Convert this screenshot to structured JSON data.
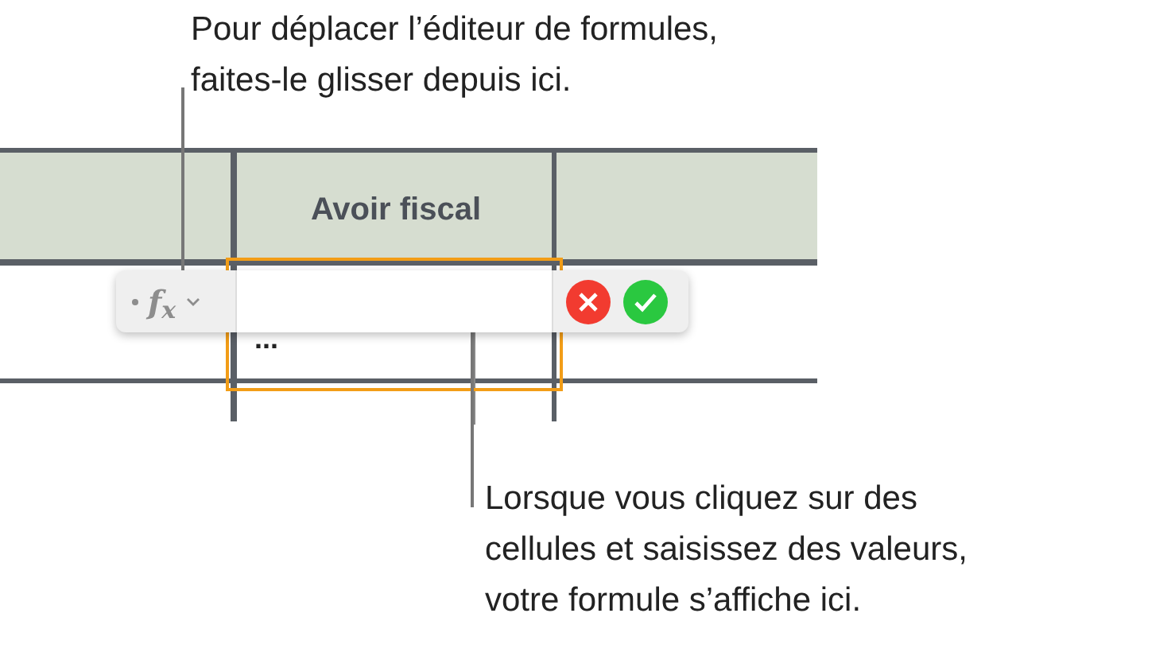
{
  "callouts": [
    {
      "kind": "top",
      "text": "Pour déplacer l’éditeur de formules,\nfaites-le glisser depuis ici."
    },
    {
      "kind": "bottom",
      "text": "Lorsque vous cliquez sur des\ncellules et saisissez des valeurs,\nvotre formule s’affiche ici."
    }
  ],
  "table": {
    "column_header": "Avoir fiscal",
    "cell_value": "..."
  },
  "formula_editor": {
    "function_label": "f$_{x}$"
  }
}
